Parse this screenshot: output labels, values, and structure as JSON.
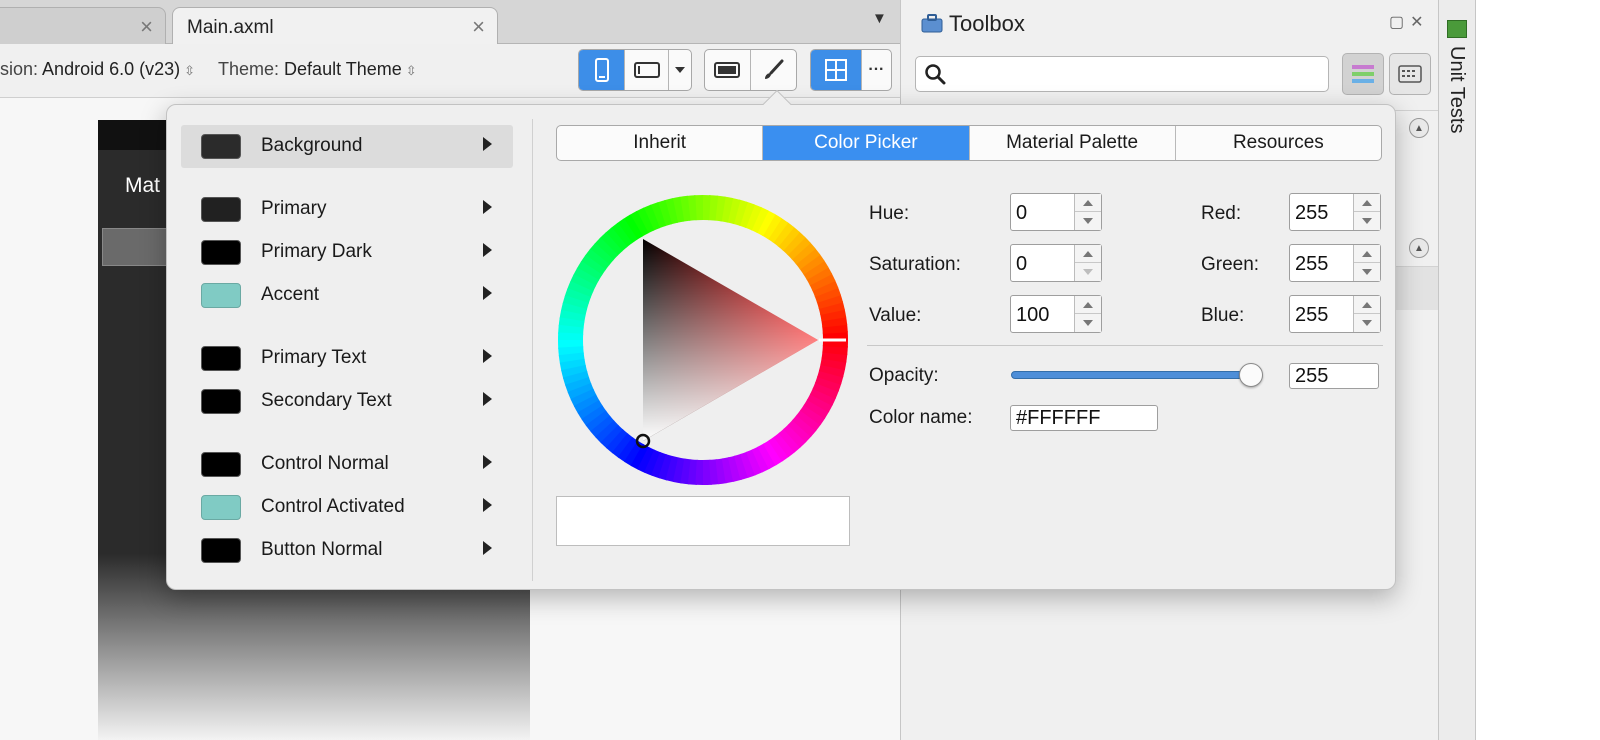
{
  "tabs": [
    {
      "label": "",
      "active": false
    },
    {
      "label": "Main.axml",
      "active": true
    }
  ],
  "toolbar": {
    "version_label": "sion:",
    "version_value": "Android 6.0 (v23)",
    "theme_label": "Theme:",
    "theme_value": "Default Theme"
  },
  "device": {
    "title": "Mat"
  },
  "toolbox": {
    "title": "Toolbox",
    "search_placeholder": ""
  },
  "side_panel": {
    "label": "Unit Tests"
  },
  "popover": {
    "properties": [
      {
        "label": "Background",
        "color": "#2b2b2b",
        "selected": true
      },
      {
        "label": "Primary",
        "color": "#212121",
        "selected": false
      },
      {
        "label": "Primary Dark",
        "color": "#000000",
        "selected": false
      },
      {
        "label": "Accent",
        "color": "#80cbc4",
        "selected": false
      },
      {
        "label": "Primary Text",
        "color": "#000000",
        "selected": false
      },
      {
        "label": "Secondary Text",
        "color": "#000000",
        "selected": false
      },
      {
        "label": "Control Normal",
        "color": "#000000",
        "selected": false
      },
      {
        "label": "Control Activated",
        "color": "#80cbc4",
        "selected": false
      },
      {
        "label": "Button Normal",
        "color": "#000000",
        "selected": false
      }
    ],
    "modes": [
      {
        "label": "Inherit",
        "active": false
      },
      {
        "label": "Color Picker",
        "active": true
      },
      {
        "label": "Material Palette",
        "active": false
      },
      {
        "label": "Resources",
        "active": false
      }
    ],
    "picker": {
      "hue_label": "Hue:",
      "hue": "0",
      "saturation_label": "Saturation:",
      "saturation": "0",
      "value_label": "Value:",
      "value": "100",
      "red_label": "Red:",
      "red": "255",
      "green_label": "Green:",
      "green": "255",
      "blue_label": "Blue:",
      "blue": "255",
      "opacity_label": "Opacity:",
      "opacity": "255",
      "opacity_fraction": 0.96,
      "color_name_label": "Color name:",
      "color_name": "#FFFFFF"
    }
  },
  "colors": {
    "accent_blue": "#3a8ff0"
  }
}
